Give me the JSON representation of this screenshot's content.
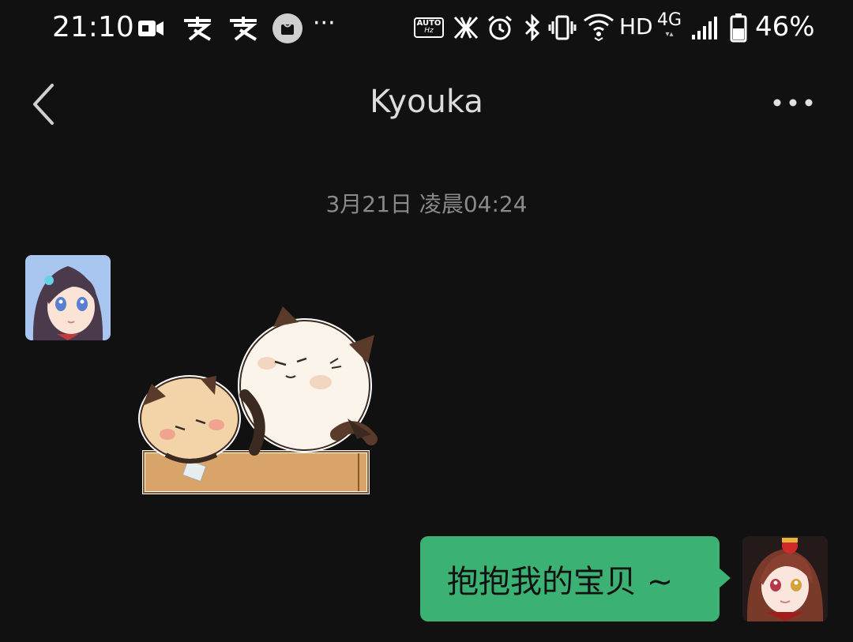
{
  "status_bar": {
    "time": "21:10",
    "hd_label": "HD",
    "network_label": "4G",
    "battery_percent": "46%",
    "auto_label": "AUTO",
    "hz_label": "Hz",
    "more_dots": "···"
  },
  "header": {
    "title": "Kyouka"
  },
  "chat": {
    "timestamp": "3月21日 凌晨04:24",
    "messages": [
      {
        "sender": "other",
        "type": "sticker"
      },
      {
        "sender": "self",
        "type": "text",
        "text": "抱抱我的宝贝 ~"
      }
    ]
  },
  "colors": {
    "background": "#111111",
    "bubble_self": "#3bb273",
    "timestamp": "#8a8a8a"
  }
}
